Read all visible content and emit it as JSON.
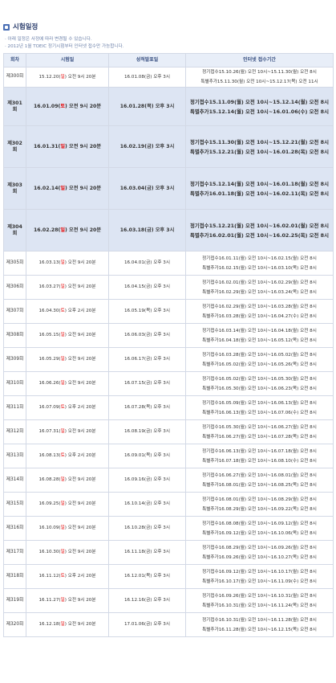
{
  "page": {
    "title": "시험일정",
    "notes": [
      "· 아래 일정은 사정에 따라 변경될 수 있습니다.",
      "· 2012년 1월 TOEIC 정기시험부터 인터넷 접수만 가능합니다."
    ]
  },
  "table": {
    "headers": [
      "회차",
      "시험일",
      "성적발표일",
      "인터넷 접수기간"
    ],
    "rows": [
      {
        "round": "제300회",
        "exam_pre": "15.12.20(",
        "exam_day": "일",
        "exam_post": ") 오전 9시 20분",
        "result": "16.01.08(금) 오후 3시",
        "reg1": "정기접수15.10.26(월) 오전 10시~15.11.30(월) 오전 8시",
        "reg2": "특별추가15.11.30(월) 오전 10시~15.12.17(목) 오전 11시"
      },
      {
        "round": "제301회",
        "exam_pre": "16.01.09(",
        "exam_day": "토",
        "exam_post": ") 오전 9시 20분",
        "result": "16.01.28(목) 오후 3시",
        "reg1": "정기접수15.11.09(월) 오전 10시~15.12.14(월) 오전 8시",
        "reg2": "특별추가15.12.14(월) 오전 10시~16.01.06(수) 오전 8시"
      },
      {
        "round": "제302회",
        "exam_pre": "16.01.31(",
        "exam_day": "일",
        "exam_post": ") 오전 9시 20분",
        "result": "16.02.19(금) 오후 3시",
        "reg1": "정기접수15.11.30(월) 오전 10시~15.12.21(월) 오전 8시",
        "reg2": "특별추가15.12.21(월) 오전 10시~16.01.28(목) 오전 8시"
      },
      {
        "round": "제303회",
        "exam_pre": "16.02.14(",
        "exam_day": "일",
        "exam_post": ") 오전 9시 20분",
        "result": "16.03.04(금) 오후 3시",
        "reg1": "정기접수15.12.14(월) 오전 10시~16.01.18(월) 오전 8시",
        "reg2": "특별추가16.01.18(월) 오전 10시~16.02.11(목) 오전 8시"
      },
      {
        "round": "제304회",
        "exam_pre": "16.02.28(",
        "exam_day": "일",
        "exam_post": ") 오전 9시 20분",
        "result": "16.03.18(금) 오후 3시",
        "reg1": "정기접수15.12.21(월) 오전 10시~16.02.01(월) 오전 8시",
        "reg2": "특별추가16.02.01(월) 오전 10시~16.02.25(목) 오전 8시"
      },
      {
        "round": "제305회",
        "exam_pre": "16.03.13(",
        "exam_day": "일",
        "exam_post": ") 오전 9시 20분",
        "result": "16.04.01(금) 오후 3시",
        "reg1": "정기접수16.01.11(월) 오전 10시~16.02.15(월) 오전 8시",
        "reg2": "특별추가16.02.15(월) 오전 10시~16.03.10(목) 오전 8시"
      },
      {
        "round": "제306회",
        "exam_pre": "16.03.27(",
        "exam_day": "일",
        "exam_post": ") 오전 9시 20분",
        "result": "16.04.15(금) 오후 3시",
        "reg1": "정기접수16.02.01(월) 오전 10시~16.02.29(월) 오전 8시",
        "reg2": "특별추가16.02.29(월) 오전 10시~16.03.24(목) 오전 8시"
      },
      {
        "round": "제307회",
        "exam_pre": "16.04.30(",
        "exam_day": "토",
        "exam_post": ") 오후 2시 20분",
        "result": "16.05.19(목) 오후 3시",
        "reg1": "정기접수16.02.29(월) 오전 10시~16.03.28(월) 오전 8시",
        "reg2": "특별추가16.03.28(월) 오전 10시~16.04.27(수) 오전 8시"
      },
      {
        "round": "제308회",
        "exam_pre": "16.05.15(",
        "exam_day": "일",
        "exam_post": ") 오전 9시 20분",
        "result": "16.06.03(금) 오후 3시",
        "reg1": "정기접수16.03.14(월) 오전 10시~16.04.18(월) 오전 8시",
        "reg2": "특별추가16.04.18(월) 오전 10시~16.05.12(목) 오전 8시"
      },
      {
        "round": "제309회",
        "exam_pre": "16.05.29(",
        "exam_day": "일",
        "exam_post": ") 오전 9시 20분",
        "result": "16.06.17(금) 오후 3시",
        "reg1": "정기접수16.03.28(월) 오전 10시~16.05.02(월) 오전 8시",
        "reg2": "특별추가16.05.02(월) 오전 10시~16.05.26(목) 오전 8시"
      },
      {
        "round": "제310회",
        "exam_pre": "16.06.26(",
        "exam_day": "일",
        "exam_post": ") 오전 9시 20분",
        "result": "16.07.15(금) 오후 3시",
        "reg1": "정기접수16.05.02(월) 오전 10시~16.05.30(월) 오전 8시",
        "reg2": "특별추가16.05.30(월) 오전 10시~16.06.23(목) 오전 8시"
      },
      {
        "round": "제311회",
        "exam_pre": "16.07.09(",
        "exam_day": "토",
        "exam_post": ") 오후 2시 20분",
        "result": "16.07.28(목) 오후 3시",
        "reg1": "정기접수16.05.09(월) 오전 10시~16.06.13(월) 오전 8시",
        "reg2": "특별추가16.06.13(월) 오전 10시~16.07.06(수) 오전 8시"
      },
      {
        "round": "제312회",
        "exam_pre": "16.07.31(",
        "exam_day": "일",
        "exam_post": ") 오전 9시 20분",
        "result": "16.08.19(금) 오후 3시",
        "reg1": "정기접수16.05.30(월) 오전 10시~16.06.27(월) 오전 8시",
        "reg2": "특별추가16.06.27(월) 오전 10시~16.07.28(목) 오전 8시"
      },
      {
        "round": "제313회",
        "exam_pre": "16.08.13(",
        "exam_day": "토",
        "exam_post": ") 오후 2시 20분",
        "result": "16.09.01(목) 오후 3시",
        "reg1": "정기접수16.06.13(월) 오전 10시~16.07.18(월) 오전 8시",
        "reg2": "특별추가16.07.18(월) 오전 10시~16.08.10(수) 오전 8시"
      },
      {
        "round": "제314회",
        "exam_pre": "16.08.28(",
        "exam_day": "일",
        "exam_post": ") 오전 9시 20분",
        "result": "16.09.16(금) 오후 3시",
        "reg1": "정기접수16.06.27(월) 오전 10시~16.08.01(월) 오전 8시",
        "reg2": "특별추가16.08.01(월) 오전 10시~16.08.25(목) 오전 8시"
      },
      {
        "round": "제315회",
        "exam_pre": "16.09.25(",
        "exam_day": "일",
        "exam_post": ") 오전 9시 20분",
        "result": "16.10.14(금) 오후 3시",
        "reg1": "정기접수16.08.01(월) 오전 10시~16.08.29(월) 오전 8시",
        "reg2": "특별추가16.08.29(월) 오전 10시~16.09.22(목) 오전 8시"
      },
      {
        "round": "제316회",
        "exam_pre": "16.10.09(",
        "exam_day": "일",
        "exam_post": ") 오전 9시 20분",
        "result": "16.10.28(금) 오후 3시",
        "reg1": "정기접수16.08.08(월) 오전 10시~16.09.12(월) 오전 8시",
        "reg2": "특별추가16.09.12(월) 오전 10시~16.10.06(목) 오전 8시"
      },
      {
        "round": "제317회",
        "exam_pre": "16.10.30(",
        "exam_day": "일",
        "exam_post": ") 오전 9시 20분",
        "result": "16.11.18(금) 오후 3시",
        "reg1": "정기접수16.08.29(월) 오전 10시~16.09.26(월) 오전 8시",
        "reg2": "특별추가16.09.26(월) 오전 10시~16.10.27(목) 오전 8시"
      },
      {
        "round": "제318회",
        "exam_pre": "16.11.12(",
        "exam_day": "토",
        "exam_post": ") 오후 2시 20분",
        "result": "16.12.01(목) 오후 3시",
        "reg1": "정기접수16.09.12(월) 오전 10시~16.10.17(월) 오전 8시",
        "reg2": "특별추가16.10.17(월) 오전 10시~16.11.09(수) 오전 8시"
      },
      {
        "round": "제319회",
        "exam_pre": "16.11.27(",
        "exam_day": "일",
        "exam_post": ") 오전 9시 20분",
        "result": "16.12.16(금) 오후 3시",
        "reg1": "정기접수16.09.26(월) 오전 10시~16.10.31(월) 오전 8시",
        "reg2": "특별추가16.10.31(월) 오전 10시~16.11.24(목) 오전 8시"
      },
      {
        "round": "제320회",
        "exam_pre": "16.12.18(",
        "exam_day": "일",
        "exam_post": ") 오전 9시 20분",
        "result": "17.01.06(금) 오후 3시",
        "reg1": "정기접수16.10.31(월) 오전 10시~16.11.28(월) 오전 8시",
        "reg2": "특별추가16.11.28(월) 오전 10시~16.12.15(목) 오전 8시"
      }
    ]
  }
}
